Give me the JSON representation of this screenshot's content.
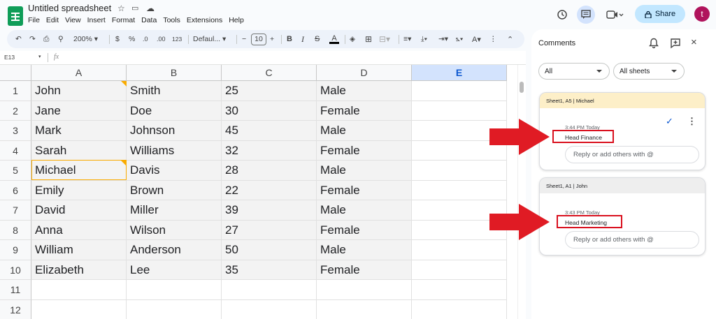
{
  "app": {
    "title": "Untitled spreadsheet",
    "menu": [
      "File",
      "Edit",
      "View",
      "Insert",
      "Format",
      "Data",
      "Tools",
      "Extensions",
      "Help"
    ],
    "share_label": "Share",
    "avatar_letter": "t"
  },
  "toolbar": {
    "zoom": "200%",
    "currency": "$",
    "percent": "%",
    "dec_less": ".0",
    "dec_more": ".00",
    "number_format": "123",
    "font": "Defaul...",
    "font_size": "10",
    "minus": "−",
    "plus": "+"
  },
  "formula_bar": {
    "cell_ref": "E13",
    "fx": "fx"
  },
  "sheet": {
    "columns": [
      "A",
      "B",
      "C",
      "D",
      "E"
    ],
    "row_numbers": [
      "1",
      "2",
      "3",
      "4",
      "5",
      "6",
      "7",
      "8",
      "9",
      "10",
      "11",
      "12"
    ],
    "rows": [
      [
        "John",
        "Smith",
        "25",
        "Male"
      ],
      [
        "Jane",
        "Doe",
        "30",
        "Female"
      ],
      [
        "Mark",
        "Johnson",
        "45",
        "Male"
      ],
      [
        "Sarah",
        "Williams",
        "32",
        "Female"
      ],
      [
        "Michael",
        "Davis",
        "28",
        "Male"
      ],
      [
        "Emily",
        "Brown",
        "22",
        "Female"
      ],
      [
        "David",
        "Miller",
        "39",
        "Male"
      ],
      [
        "Anna",
        "Wilson",
        "27",
        "Female"
      ],
      [
        "William",
        "Anderson",
        "50",
        "Male"
      ],
      [
        "Elizabeth",
        "Lee",
        "35",
        "Female"
      ]
    ]
  },
  "comments_panel": {
    "title": "Comments",
    "filter_all": "All",
    "filter_sheets": "All sheets",
    "comments": [
      {
        "header": "Sheet1, A5 | Michael",
        "time": "3:44 PM Today",
        "text": "Head Finance",
        "reply_placeholder": "Reply or add others with @"
      },
      {
        "header": "Sheet1, A1 | John",
        "time": "3:43 PM Today",
        "text": "Head Marketing",
        "reply_placeholder": "Reply or add others with @"
      }
    ]
  },
  "colors": {
    "comment_header_active": "#fdefc8",
    "comment_header": "#eeeeee",
    "selected_column": "#d3e3fd",
    "annotation_red": "#e01b24",
    "share_bg": "#c2e7ff"
  }
}
